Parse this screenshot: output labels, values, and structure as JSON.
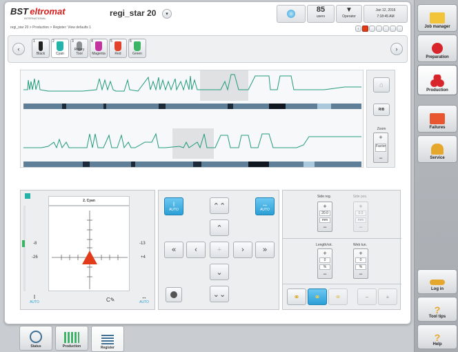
{
  "header": {
    "brand_prefix": "BST",
    "brand_suffix": "eltromat",
    "brand_sub": "INTERNATIONAL",
    "job_title": "regi_star 20",
    "counter_value": "85",
    "counter_label": "users",
    "operator_label": "Operator",
    "date": "Jan 12, 2016",
    "time": "7:18:45 AM",
    "breadcrumb": "regi_star 20 > Production > Register: View defaults 1"
  },
  "tools": [
    {
      "num": "1",
      "label": "Black",
      "color": "#222222"
    },
    {
      "num": "2",
      "label": "Cyan",
      "color": "#25b3a9"
    },
    {
      "num": "3",
      "label": "Rotary Tool",
      "color": "#8a8f93"
    },
    {
      "num": "4",
      "label": "Magenta",
      "color": "#c2349e"
    },
    {
      "num": "5",
      "label": "Red",
      "color": "#e2412a"
    },
    {
      "num": "6",
      "label": "Green",
      "color": "#3bb466"
    }
  ],
  "right_panel": {
    "btn_label": "RIB",
    "zoom_label": "Zoom",
    "factor_label": "Factor"
  },
  "target": {
    "title": "2. Cyan",
    "left_top": "-8",
    "left_bottom": "-26",
    "right_top": "-13",
    "right_bottom": "+4",
    "auto_left": "AUTO",
    "auto_right": "AUTO"
  },
  "controls": {
    "auto_left": "AUTO",
    "auto_right": "AUTO"
  },
  "params": {
    "side_reg_label": "Side reg.",
    "side_reg_value": "20.0",
    "side_reg_unit": "mm",
    "side_pos_label": "Side pos.",
    "side_pos_value": "0.0",
    "side_pos_unit": "mm",
    "length_label": "Length/rot.",
    "length_value": "0",
    "length_unit": "%",
    "web_label": "Web tun.",
    "web_value": "0",
    "web_unit": "%"
  },
  "bottom_tabs": [
    {
      "label": "Status"
    },
    {
      "label": "Production"
    },
    {
      "label": "Register"
    }
  ],
  "sidebar": {
    "items": [
      {
        "label": "Job manager"
      },
      {
        "label": "Preparation"
      },
      {
        "label": "Production"
      },
      {
        "label": "Failures"
      },
      {
        "label": "Service"
      },
      {
        "label": "Log in"
      },
      {
        "label": "Tool tips"
      },
      {
        "label": "Help"
      }
    ]
  },
  "colors": {
    "accent_blue": "#2b9fd6",
    "signal_green": "#1f9a77",
    "alarm_red": "#e23b1a"
  }
}
